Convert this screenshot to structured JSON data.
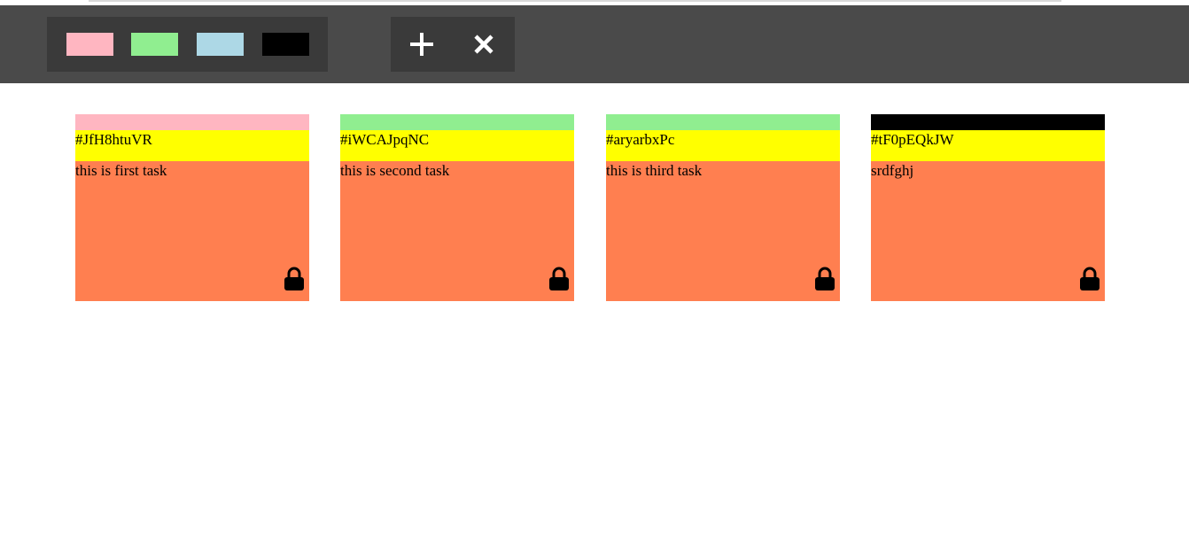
{
  "toolbar": {
    "palette": [
      {
        "name": "pink",
        "color": "#ffb6c1"
      },
      {
        "name": "lightgreen",
        "color": "#90ee90"
      },
      {
        "name": "lightblue",
        "color": "#add8e6"
      },
      {
        "name": "black",
        "color": "#000000"
      }
    ],
    "actions": [
      {
        "name": "add",
        "icon": "plus-icon"
      },
      {
        "name": "remove",
        "icon": "close-icon"
      }
    ]
  },
  "tickets": [
    {
      "color": "#ffb6c1",
      "id": "#JfH8htuVR",
      "task": "this is first task",
      "icon": "lock-icon"
    },
    {
      "color": "#90ee90",
      "id": "#iWCAJpqNC",
      "task": "this is second task",
      "icon": "lock-icon"
    },
    {
      "color": "#90ee90",
      "id": "#aryarbxPc",
      "task": "this is third task",
      "icon": "lock-icon"
    },
    {
      "color": "#000000",
      "id": "#tF0pEQkJW",
      "task": "srdfghj",
      "icon": "lock-icon"
    }
  ],
  "colors": {
    "toolbar_bg": "#4a4a4a",
    "group_bg": "#3a3a3a",
    "ticket_bg": "#ff7f50",
    "id_bg": "#ffff00"
  }
}
